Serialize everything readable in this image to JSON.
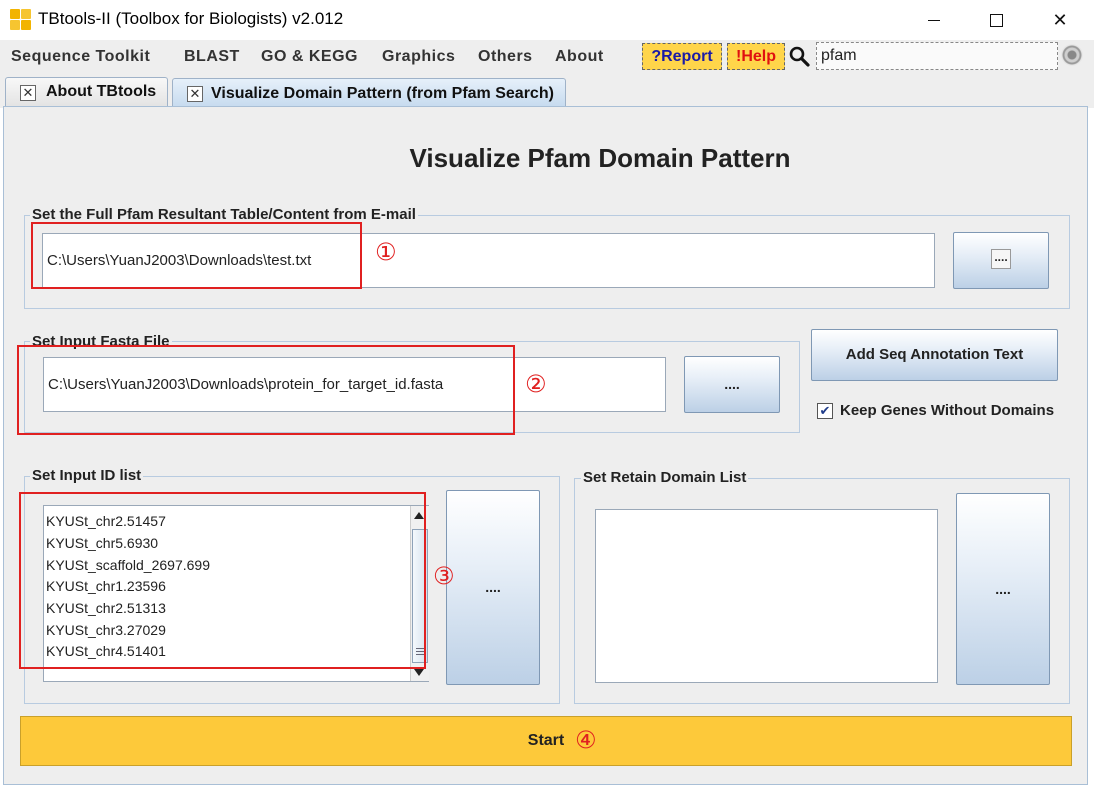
{
  "window": {
    "title": "TBtools-II (Toolbox for Biologists) v2.012",
    "controls": {
      "minimize": "minimize-icon",
      "maximize": "maximize-icon",
      "close": "✕"
    }
  },
  "menu": {
    "items": [
      "Sequence Toolkit",
      "BLAST",
      "GO & KEGG",
      "Graphics",
      "Others",
      "About"
    ],
    "report_label": "?Report",
    "help_label": "!Help",
    "search_value": "pfam"
  },
  "tabs": [
    {
      "label": "About TBtools",
      "close": "✕"
    },
    {
      "label": "Visualize Domain Pattern (from Pfam Search)",
      "close": "✕"
    }
  ],
  "main": {
    "heading": "Visualize Pfam Domain Pattern",
    "pfam_table": {
      "title": "Set the Full Pfam Resultant Table/Content from E-mail",
      "value": "C:\\Users\\YuanJ2003\\Downloads\\test.txt",
      "browse_label": "...."
    },
    "fasta": {
      "title": "Set Input Fasta File",
      "value": "C:\\Users\\YuanJ2003\\Downloads\\protein_for_target_id.fasta",
      "browse_label": "...."
    },
    "add_annotation_label": "Add Seq Annotation Text",
    "keep_genes": {
      "checked": true,
      "mark": "✔",
      "label": "Keep Genes Without Domains"
    },
    "id_list": {
      "title": "Set Input ID list",
      "items": [
        "KYUSt_chr2.51457",
        "KYUSt_chr5.6930",
        "KYUSt_scaffold_2697.699",
        "KYUSt_chr1.23596",
        "KYUSt_chr2.51313",
        "KYUSt_chr3.27029",
        "KYUSt_chr4.51401"
      ],
      "browse_label": "...."
    },
    "retain_domain": {
      "title": "Set Retain Domain List",
      "browse_label": "...."
    },
    "start_label": "Start"
  },
  "annotations": {
    "markers": [
      "①",
      "②",
      "③",
      "④"
    ],
    "color": "#e02020"
  }
}
